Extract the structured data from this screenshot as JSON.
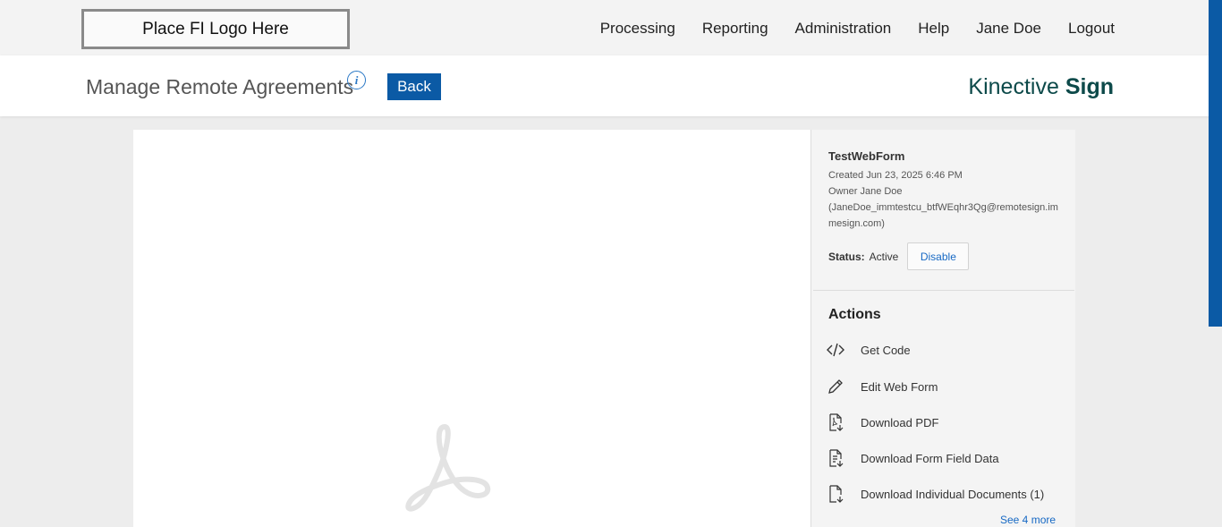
{
  "topbar": {
    "logo_text": "Place FI Logo Here",
    "nav": [
      "Processing",
      "Reporting",
      "Administration",
      "Help",
      "Jane Doe",
      "Logout"
    ]
  },
  "header": {
    "title": "Manage Remote Agreements",
    "info_icon": "info-icon",
    "back_label": "Back",
    "brand_light": "Kinective",
    "brand_bold": "Sign"
  },
  "details": {
    "name": "TestWebForm",
    "created": "Created Jun 23, 2025 6:46 PM",
    "owner": "Owner Jane Doe",
    "owner_email": "(JaneDoe_immtestcu_btfWEqhr3Qg@remotesign.immesign.com)",
    "status_label": "Status:",
    "status_value": "Active",
    "disable_label": "Disable"
  },
  "actions": {
    "title": "Actions",
    "items": [
      {
        "label": "Get Code",
        "icon": "code-icon"
      },
      {
        "label": "Edit Web Form",
        "icon": "pencil-icon"
      },
      {
        "label": "Download PDF",
        "icon": "pdf-download-icon"
      },
      {
        "label": "Download Form Field Data",
        "icon": "form-data-download-icon"
      },
      {
        "label": "Download Individual Documents (1)",
        "icon": "document-download-icon"
      }
    ],
    "see_more": "See 4 more"
  },
  "colors": {
    "accent_blue": "#0b5aa5",
    "link_blue": "#1769c4",
    "brand_teal": "#0d4a4a"
  }
}
